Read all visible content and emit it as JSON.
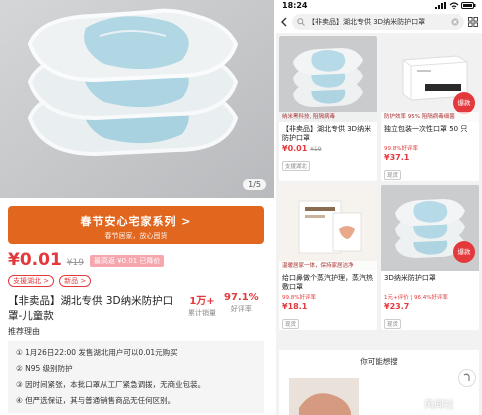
{
  "left": {
    "image_counter": "1/5",
    "promo": {
      "title": "春节安心宅家系列 >",
      "subtitle": "春节居家，放心囤货"
    },
    "price": "¥0.01",
    "original_price": "¥19",
    "pay_badge": "最高返 ¥0.01 已降价",
    "tags": [
      "支援湖北 >",
      "新品 >"
    ],
    "title": "【非卖品】湖北专供 3D纳米防护口罩-儿童款",
    "stats": [
      {
        "value": "1万+",
        "label": "累计销量"
      },
      {
        "value": "97.1%",
        "label": "好评率"
      }
    ],
    "reason_label": "推荐理由",
    "reasons": [
      "① 1月26日22:00 发售湖北用户可以0.01元购买",
      "② N95 级别防护",
      "③ 因时间紧张，本批口罩从工厂紧急调拨，无商业包装。",
      "④ 但严选保证，其与普通销售商品无任何区别。"
    ]
  },
  "right": {
    "status_bar": {
      "time": "18:24"
    },
    "search": {
      "text": "【非卖品】湖北专供 3D纳米防护口罩"
    },
    "products": [
      {
        "caption": "纳米黑科技, 阻隔病毒",
        "title": "【非卖品】湖北专供 3D纳米防护口罩",
        "rate": "",
        "price": "¥0.01",
        "old_price": "¥19",
        "tag": "支援湖北",
        "hot": ""
      },
      {
        "caption": "防护效率 95%  阻隔病毒细菌",
        "title": "独立包装一次性口罩 50 只",
        "rate": "99.8%好评率",
        "price": "¥37.1",
        "old_price": "",
        "tag": "现货",
        "hot": "爆款"
      },
      {
        "caption": "温暖居家一体，保持家居洁净",
        "title": "给口鼻做个蒸汽护理，蒸汽热敷口罩",
        "rate": "99.8%好评率",
        "price": "¥18.1",
        "old_price": "",
        "tag": "现货",
        "hot": ""
      },
      {
        "caption": "",
        "title": "3D纳米防护口罩",
        "rate": "1元+评价 | 96.4%好评率",
        "price": "¥23.7",
        "old_price": "",
        "tag": "现货",
        "hot": "爆款"
      }
    ],
    "recommend_title": "你可能想搜",
    "watermark": "风闻社"
  }
}
